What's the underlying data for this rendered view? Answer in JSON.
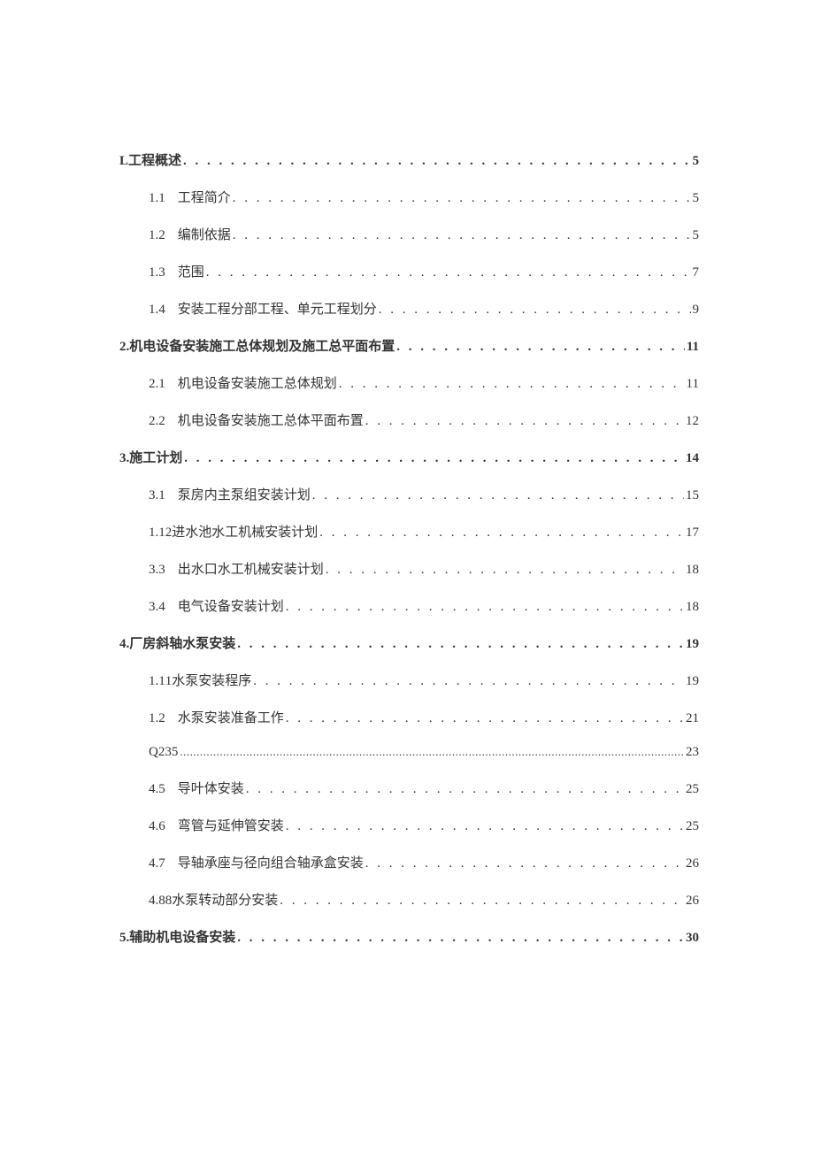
{
  "entries": [
    {
      "level": 1,
      "num": "L",
      "title": "工程概述",
      "page": "5",
      "gap": false,
      "tight": false,
      "bold_page": true
    },
    {
      "level": 2,
      "num": "1.1",
      "title": "工程简介",
      "page": "5",
      "gap": true,
      "tight": false,
      "bold_page": false
    },
    {
      "level": 2,
      "num": "1.2",
      "title": "编制依据",
      "page": "5",
      "gap": true,
      "tight": false,
      "bold_page": false
    },
    {
      "level": 2,
      "num": "1.3",
      "title": "范围",
      "page": "7",
      "gap": true,
      "tight": false,
      "bold_page": false
    },
    {
      "level": 2,
      "num": "1.4",
      "title": "安装工程分部工程、单元工程划分",
      "page": "9",
      "gap": true,
      "tight": false,
      "bold_page": false
    },
    {
      "level": 1,
      "num": "2",
      "title": ".机电设备安装施工总体规划及施工总平面布置",
      "page": "11",
      "gap": false,
      "tight": false,
      "bold_page": true
    },
    {
      "level": 2,
      "num": "2.1",
      "title": "机电设备安装施工总体规划",
      "page": "11",
      "gap": true,
      "tight": false,
      "bold_page": false
    },
    {
      "level": 2,
      "num": "2.2",
      "title": "机电设备安装施工总体平面布置",
      "page": "12",
      "gap": true,
      "tight": false,
      "bold_page": false
    },
    {
      "level": 1,
      "num": "3",
      "title": ".施工计划",
      "page": "14",
      "gap": false,
      "tight": false,
      "bold_page": true
    },
    {
      "level": 2,
      "num": "3.1",
      "title": "泵房内主泵组安装计划",
      "page": "15",
      "gap": true,
      "tight": false,
      "bold_page": false
    },
    {
      "level": 2,
      "num": "1.1",
      "title": " 2进水池水工机械安装计划",
      "page": "17",
      "gap": false,
      "tight": false,
      "bold_page": false
    },
    {
      "level": 2,
      "num": "3.3",
      "title": "出水口水工机械安装计划",
      "page": "18",
      "gap": true,
      "tight": false,
      "bold_page": false
    },
    {
      "level": 2,
      "num": "3.4",
      "title": "电气设备安装计划",
      "page": "18",
      "gap": true,
      "tight": false,
      "bold_page": false
    },
    {
      "level": 1,
      "num": "4.",
      "title": "厂房斜轴水泵安装",
      "page": "19",
      "gap": false,
      "tight": false,
      "bold_page": true
    },
    {
      "level": 2,
      "num": "1.1",
      "title": " 1水泵安装程序",
      "page": "19",
      "gap": false,
      "tight": false,
      "bold_page": false
    },
    {
      "level": 2,
      "num": "1.2",
      "title": "水泵安装准备工作",
      "page": "21",
      "gap": true,
      "tight": false,
      "bold_page": false
    },
    {
      "level": 2,
      "num": "",
      "title": "Q235",
      "page": "23",
      "gap": false,
      "tight": true,
      "bold_page": false
    },
    {
      "level": 2,
      "num": "4.5",
      "title": "导叶体安装",
      "page": "25",
      "gap": true,
      "tight": false,
      "bold_page": false
    },
    {
      "level": 2,
      "num": "4.6",
      "title": "弯管与延伸管安装",
      "page": "25",
      "gap": true,
      "tight": false,
      "bold_page": false
    },
    {
      "level": 2,
      "num": "4.7",
      "title": "导轴承座与径向组合轴承盒安装",
      "page": "26",
      "gap": true,
      "tight": false,
      "bold_page": false
    },
    {
      "level": 2,
      "num": "4.8",
      "title": " 8水泵转动部分安装",
      "page": "26",
      "gap": false,
      "tight": false,
      "bold_page": false
    },
    {
      "level": 1,
      "num": "5.",
      "title": "辅助机电设备安装",
      "page": "30",
      "gap": false,
      "tight": false,
      "bold_page": true
    }
  ],
  "dot_fill": ". . . . . . . . . . . . . . . . . . . . . . . . . . . . . . . . . . . . . . . . . . . . . . . . . . . . . . . . . . . . . . . . . . . . . . . . . . . . . . . . . . . . . . . . . . . . . . . . . . . . . . . . . . . . . . . . . . . . . . . .",
  "dot_fill_tight": "........................................................................................................................................................................................................................................................"
}
